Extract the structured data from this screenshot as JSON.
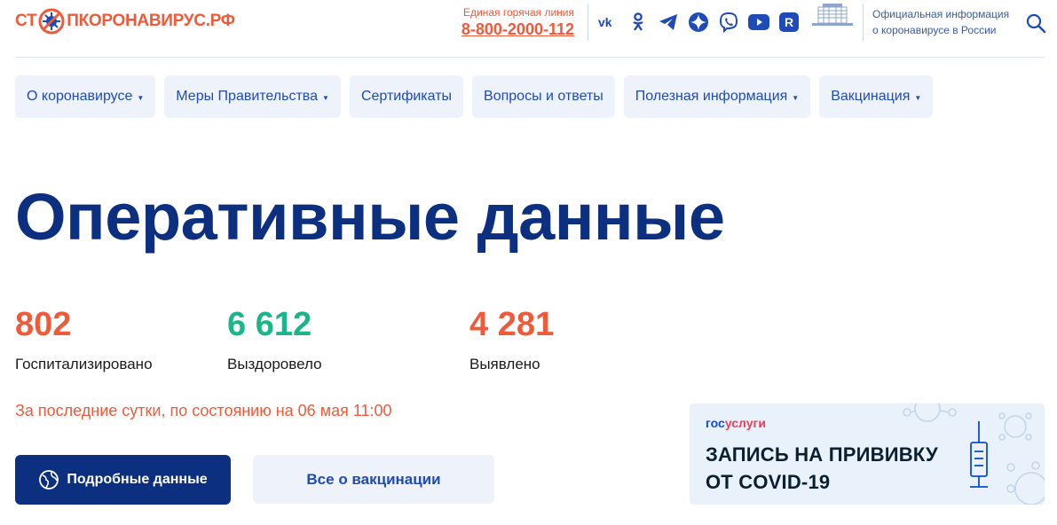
{
  "header": {
    "logo": {
      "part1": "СТ",
      "part2": "ПКОРОНАВИРУС",
      "part3": ".РФ"
    },
    "hotline": {
      "caption": "Единая горячая линия",
      "number": "8-800-2000-112"
    },
    "socials": [
      "vk-icon",
      "odnoklassniki-icon",
      "telegram-icon",
      "yandex-zen-icon",
      "viber-icon",
      "youtube-icon",
      "rutube-icon"
    ],
    "official": {
      "line1": "Официальная информация",
      "line2": "о коронавирусе в России"
    }
  },
  "nav": {
    "items": [
      {
        "label": "О коронавирусе",
        "arrow": "▼"
      },
      {
        "label": "Меры Правительства",
        "arrow": "▼"
      },
      {
        "label": "Сертификаты",
        "arrow": ""
      },
      {
        "label": "Вопросы и ответы",
        "arrow": ""
      },
      {
        "label": "Полезная информация",
        "arrow": "▼"
      },
      {
        "label": "Вакцинация",
        "arrow": "▼"
      }
    ]
  },
  "main": {
    "title": "Оперативные данные",
    "stats": [
      {
        "value": "802",
        "label": "Госпитализировано",
        "color": "#ef5a3b"
      },
      {
        "value": "6 612",
        "label": "Выздоровело",
        "color": "#1cb48a"
      },
      {
        "value": "4 281",
        "label": "Выявлено",
        "color": "#ef5a3b"
      }
    ],
    "updated": "За последние сутки, по состоянию на 06 мая 11:00",
    "buttons": {
      "details": "Подробные данные",
      "vaccination": "Все о вакцинации"
    }
  },
  "banner": {
    "brand_part1": "гос",
    "brand_part2": "услуги",
    "line1": "ЗАПИСЬ НА ПРИВИВКУ",
    "line2": "ОТ COVID-19"
  },
  "colors": {
    "accent_red": "#ef5a3b",
    "brand_blue": "#1f4bb8",
    "dark_blue": "#0c2f7f",
    "green": "#1cb48a"
  }
}
